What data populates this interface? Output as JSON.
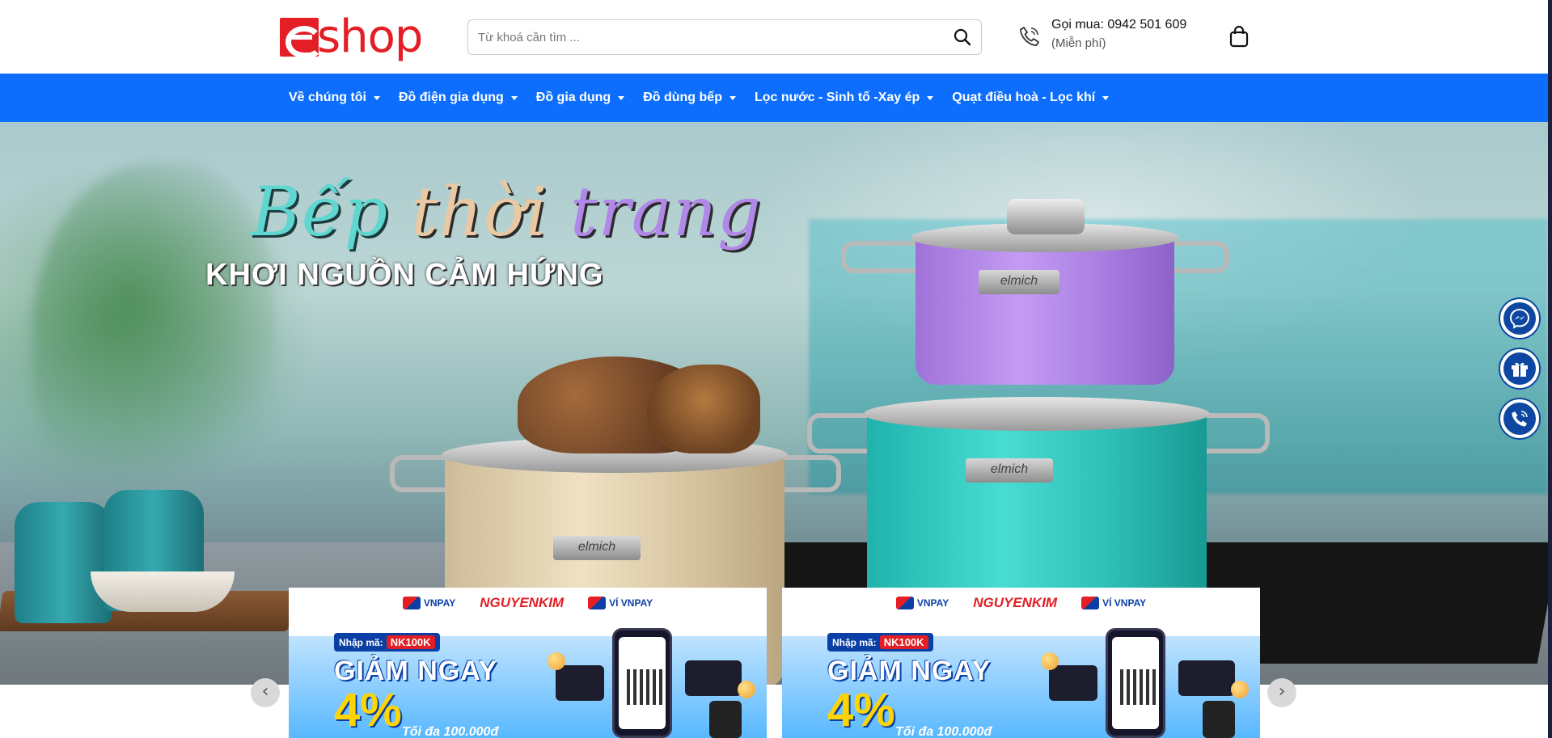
{
  "header": {
    "logo_text": "shop",
    "search_placeholder": "Từ khoá cần tìm ...",
    "hotline_label": "Gọi mua: 0942 501 609",
    "hotline_note": "(Miễn phí)"
  },
  "nav": {
    "items": [
      {
        "label": "Về chúng tôi"
      },
      {
        "label": "Đồ điện gia dụng"
      },
      {
        "label": "Đồ gia dụng"
      },
      {
        "label": "Đồ dùng bếp"
      },
      {
        "label": "Lọc nước - Sinh tố -Xay ép"
      },
      {
        "label": "Quạt điều hoà - Lọc khí"
      }
    ]
  },
  "hero": {
    "script_word1": "Bếp",
    "script_word2": "thời",
    "script_word3": "trang",
    "subtitle": "KHƠI NGUỒN CẢM HỨNG",
    "pot_brand": "elmich",
    "colors": {
      "teal": "#5fd6cf",
      "beige": "#e9c9a3",
      "lavender": "#b089e8"
    }
  },
  "slider": {
    "prev_icon": "chevron-left-icon",
    "next_icon": "chevron-right-icon"
  },
  "floating": {
    "messenger_icon": "messenger-icon",
    "gift_icon": "gift-icon",
    "phone_icon": "phone-icon"
  },
  "promos": [
    {
      "brand1": "VNPAY",
      "brand2": "NGUYENKIM",
      "brand3": "VÍ VNPAY",
      "code_label": "Nhập mã:",
      "code": "NK100K",
      "headline": "GIẢM NGAY",
      "percent": "4%",
      "max_text": "Tối đa 100.000đ"
    },
    {
      "brand1": "VNPAY",
      "brand2": "NGUYENKIM",
      "brand3": "VÍ VNPAY",
      "code_label": "Nhập mã:",
      "code": "NK100K",
      "headline": "GIẢM NGAY",
      "percent": "4%",
      "max_text": "Tối đa 100.000đ"
    }
  ],
  "theme": {
    "brand_red": "#e31e24",
    "nav_blue": "#0d6efd",
    "float_blue": "#0d47a1"
  }
}
